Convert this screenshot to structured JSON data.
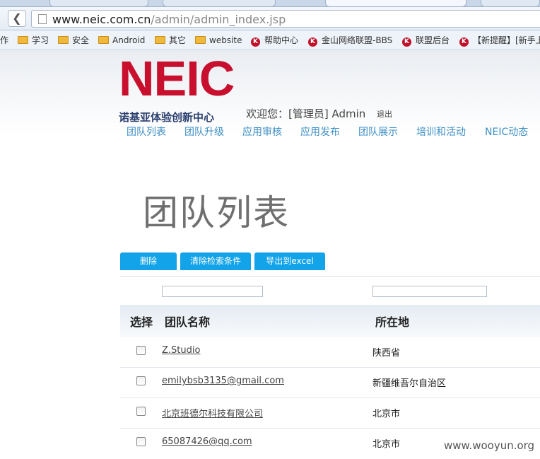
{
  "browser": {
    "back_glyph": "❮",
    "url_host": "www.neic.com.cn",
    "url_path": "/admin/admin_index.jsp",
    "bookmarks": [
      {
        "label": "作",
        "icon": "none"
      },
      {
        "label": "学习",
        "icon": "folder-icon"
      },
      {
        "label": "安全",
        "icon": "folder-icon"
      },
      {
        "label": "Android",
        "icon": "folder-icon"
      },
      {
        "label": "其它",
        "icon": "folder-icon"
      },
      {
        "label": "website",
        "icon": "folder-icon"
      },
      {
        "label": "帮助中心",
        "icon": "k-site-icon"
      },
      {
        "label": "金山网络联盟-BBS",
        "icon": "k-site-icon"
      },
      {
        "label": "联盟后台",
        "icon": "k-site-icon"
      },
      {
        "label": "【新提醒】[新手上",
        "icon": "k-site-icon"
      }
    ]
  },
  "header": {
    "logo_text": "NEIC",
    "logo_subtitle": "诺基亚体验创新中心",
    "welcome": "欢迎您：[管理员] Admin",
    "logout": "退出"
  },
  "nav": [
    "团队列表",
    "团队升级",
    "应用审核",
    "应用发布",
    "团队展示",
    "培训和活动",
    "NEIC动态"
  ],
  "page_title": "团队列表",
  "toolbar": {
    "delete": "删除",
    "clear_filters": "清除检索条件",
    "export": "导出到excel"
  },
  "filters": {
    "name_value": "",
    "location_value": ""
  },
  "table": {
    "headers": {
      "select": "选择",
      "name": "团队名称",
      "location": "所在地"
    },
    "rows": [
      {
        "name": "Z.Studio",
        "location": "陕西省"
      },
      {
        "name": "emilybsb3135@gmail.com",
        "location": "新疆维吾尔自治区"
      },
      {
        "name": "北京班德尔科技有限公司",
        "location": "北京市"
      },
      {
        "name": "65087426@qq.com",
        "location": "北京市"
      }
    ]
  },
  "watermark": "www.wooyun.org",
  "colors": {
    "brand_red": "#c8102e",
    "nav_blue": "#3d8fc4",
    "button_blue": "#12a3e8"
  }
}
